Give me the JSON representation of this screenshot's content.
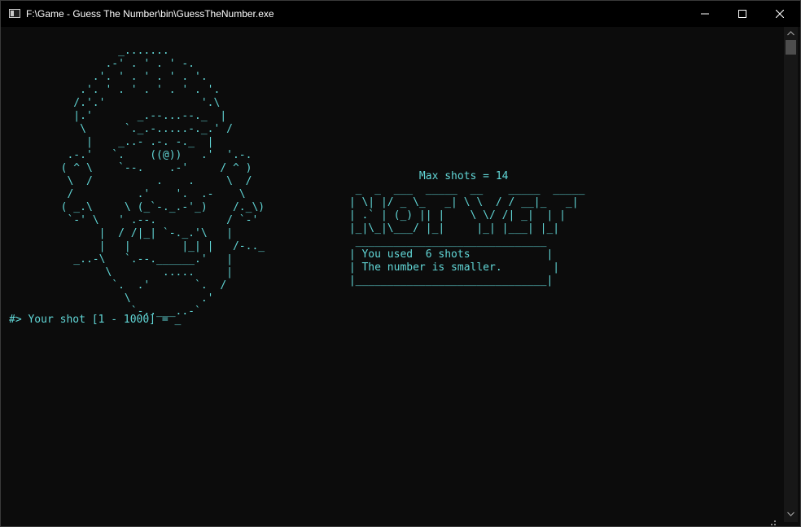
{
  "window": {
    "title": "F:\\Game - Guess The Number\\bin\\GuessTheNumber.exe",
    "icon": "console-app-icon",
    "controls": {
      "minimize": "minimize-icon",
      "maximize": "maximize-icon",
      "close": "close-icon"
    }
  },
  "console": {
    "face_art": "           _.......\n         .-' . ' . ' -.\n       .'. ' . ' . ' . '.\n     .'. ' . ' . ' . ' . '.\n    /.'.'               '.\\\n    |.'       _.--...--._  |\n     \\      `._.-.....-._.' /\n      |    _..- .-. -._  |\n   .-.'   `.    ((@))   .'  '.-.\n  ( ^ \\    `--.    .-'     / ^ )\n   \\  /          .    .     \\  /\n   /          .'    '.  .-    \\\n  ( _.\\     \\ (_`-._.-'_)    /._\\)\n   `-' \\   ' .--.           / `-'\n        |  / /|_| `-._.'\\   |\n        |   |        |_| |   /-.._\n    _..-\\   `.--.______.'   |\n         \\        .....     |\n          `.  .'       `.  /\n            \\           .'\n             `-..___..-`",
    "max_shots_line": "            Max shots = 14",
    "game_over_art": "  _  _  ___  _____  __    _____  _____\n | \\| |/ _ \\_   _| \\ \\  / / __|_   _|\n | .` | (_) || |    \\ \\/ /| _|  | |\n |_|\\_|\\___/ |_|     |_| |___| |_|",
    "message_box": "  ______________________________\n | You used  6 shots            |\n | The number is smaller.        |\n |______________________________|",
    "prompt": "#> Your shot [1 - 1000] = _"
  },
  "colors": {
    "terminal_text": "#61d6d6",
    "background": "#0c0c0c",
    "titlebar": "#000000"
  }
}
